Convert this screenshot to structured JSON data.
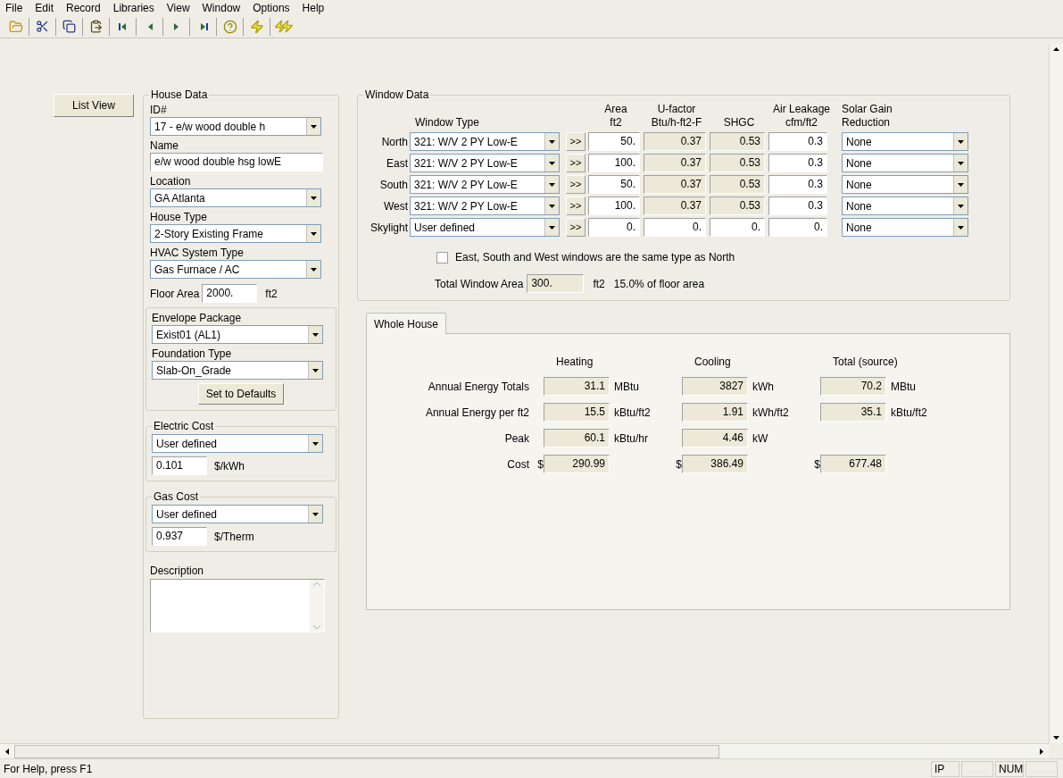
{
  "menu": [
    "File",
    "Edit",
    "Record",
    "Libraries",
    "View",
    "Window",
    "Options",
    "Help"
  ],
  "list_view_button": "List View",
  "house_data": {
    "title": "House Data",
    "fields": [
      {
        "kind": "dropdown",
        "label": "ID#",
        "value": "17 - e/w wood double h"
      },
      {
        "kind": "text",
        "label": "Name",
        "value": "e/w wood double hsg lowE"
      },
      {
        "kind": "dropdown",
        "label": "Location",
        "value": "GA Atlanta"
      },
      {
        "kind": "dropdown",
        "label": "House Type",
        "value": "2-Story Existing Frame"
      },
      {
        "kind": "dropdown",
        "label": "HVAC System Type",
        "value": "Gas Furnace / AC"
      }
    ],
    "floor_area": {
      "label": "Floor Area",
      "value": "2000.",
      "unit": "ft2"
    },
    "envelope": {
      "fields": [
        {
          "kind": "dropdown",
          "label": "Envelope Package",
          "value": "Exist01 (AL1)"
        },
        {
          "kind": "dropdown",
          "label": "Foundation Type",
          "value": "Slab-On_Grade"
        }
      ],
      "button": "Set to Defaults"
    },
    "costs": [
      {
        "title": "Electric Cost",
        "option": "User defined",
        "rate": "0.101",
        "unit": "$/kWh"
      },
      {
        "title": "Gas Cost",
        "option": "User defined",
        "rate": "0.937",
        "unit": "$/Therm"
      }
    ],
    "description": {
      "label": "Description"
    }
  },
  "window_data": {
    "title": "Window Data",
    "columns": [
      {
        "title": "Window Type"
      },
      {
        "title": "Area",
        "unit": "ft2"
      },
      {
        "title": "U-factor",
        "unit": "Btu/h-ft2-F"
      },
      {
        "title": "SHGC"
      },
      {
        "title": "Air Leakage",
        "unit": "cfm/ft2"
      },
      {
        "title": "Solar Gain Reduction"
      }
    ],
    "rows": [
      {
        "orientation": "North",
        "window_type": "321: W/V 2 PY Low-E",
        "copy": ">>",
        "area": "50.",
        "u_factor": "0.37",
        "shgc": "0.53",
        "air_leakage": "0.3",
        "solar_gain": "None",
        "readonly": true
      },
      {
        "orientation": "East",
        "window_type": "321: W/V 2 PY Low-E",
        "copy": ">>",
        "area": "100.",
        "u_factor": "0.37",
        "shgc": "0.53",
        "air_leakage": "0.3",
        "solar_gain": "None",
        "readonly": true
      },
      {
        "orientation": "South",
        "window_type": "321: W/V 2 PY Low-E",
        "copy": ">>",
        "area": "50.",
        "u_factor": "0.37",
        "shgc": "0.53",
        "air_leakage": "0.3",
        "solar_gain": "None",
        "readonly": true
      },
      {
        "orientation": "West",
        "window_type": "321: W/V 2 PY Low-E",
        "copy": ">>",
        "area": "100.",
        "u_factor": "0.37",
        "shgc": "0.53",
        "air_leakage": "0.3",
        "solar_gain": "None",
        "readonly": true
      },
      {
        "orientation": "Skylight",
        "window_type": "User defined",
        "copy": ">>",
        "area": "0.",
        "u_factor": "0.",
        "shgc": "0.",
        "air_leakage": "0.",
        "solar_gain": "None",
        "readonly": false
      }
    ],
    "same_type": {
      "label": "East, South and West windows are the same type as North",
      "checked": false
    },
    "total": {
      "label": "Total Window Area",
      "value": "300.",
      "unit": "ft2",
      "percent": "15.0% of floor area"
    }
  },
  "results": {
    "tabs": [
      {
        "label": "Whole House",
        "selected": true
      }
    ],
    "columns": [
      "Heating",
      "Cooling",
      "Total (source)"
    ],
    "rows": [
      {
        "label": "Annual Energy Totals",
        "cells": [
          {
            "value": "31.1",
            "unit": "MBtu"
          },
          {
            "value": "3827",
            "unit": "kWh"
          },
          {
            "value": "70.2",
            "unit": "MBtu"
          }
        ]
      },
      {
        "label": "Annual Energy per  ft2",
        "cells": [
          {
            "value": "15.5",
            "unit": "kBtu/ft2"
          },
          {
            "value": "1.91",
            "unit": "kWh/ft2"
          },
          {
            "value": "35.1",
            "unit": "kBtu/ft2"
          }
        ]
      },
      {
        "label": "Peak",
        "cells": [
          {
            "value": "60.1",
            "unit": "kBtu/hr"
          },
          {
            "value": "4.46",
            "unit": "kW"
          }
        ]
      },
      {
        "label": "Cost",
        "cells": [
          {
            "prefix": "$",
            "value": "290.99"
          },
          {
            "prefix": "$",
            "value": "386.49"
          },
          {
            "prefix": "$",
            "value": "677.48"
          }
        ]
      }
    ]
  },
  "status_bar": {
    "message": "For Help, press F1",
    "panels": [
      "IP",
      "NUM"
    ]
  }
}
